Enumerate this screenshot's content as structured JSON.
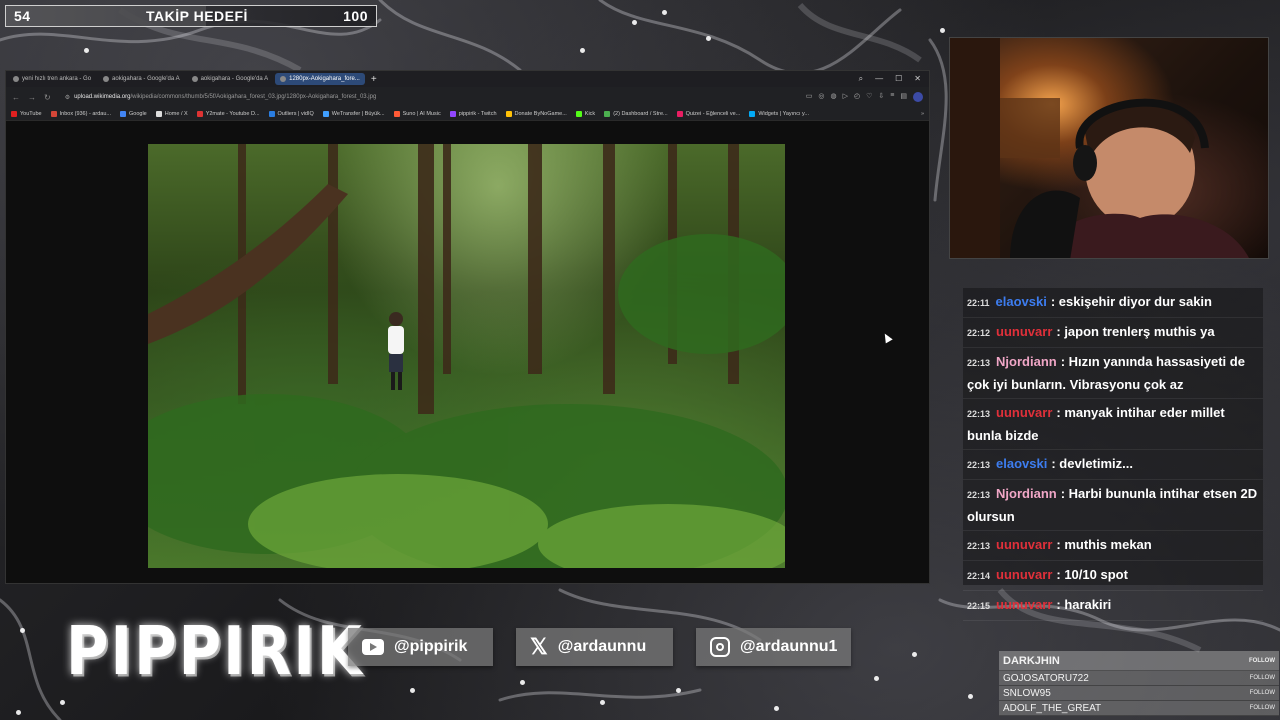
{
  "goal": {
    "current": "54",
    "title": "TAKİP HEDEFİ",
    "target": "100",
    "progress_fraction": 0.54
  },
  "browser": {
    "tabs": [
      {
        "label": "yeni hızlı tren ankara - Go",
        "active": false
      },
      {
        "label": "aokigahara - Google'da A",
        "active": false
      },
      {
        "label": "aokigahara - Google'da A",
        "active": false
      },
      {
        "label": "1280px-Aokigahara_fore...",
        "active": true
      }
    ],
    "url_host": "upload.wikimedia.org",
    "url_path": "/wikipedia/commons/thumb/5/5f/Aokigahara_forest_03.jpg/1280px-Aokigahara_forest_03.jpg",
    "bookmarks": [
      {
        "label": "YouTube",
        "color": "#e02020"
      },
      {
        "label": "Inbox (936) - ardau...",
        "color": "#d44638"
      },
      {
        "label": "Google",
        "color": "#4285f4"
      },
      {
        "label": "Home / X",
        "color": "#dddddd"
      },
      {
        "label": "Y2mate - Youtube D...",
        "color": "#d33"
      },
      {
        "label": "Outliers | vidIQ",
        "color": "#2a7de1"
      },
      {
        "label": "WeTransfer | Büyük...",
        "color": "#409fff"
      },
      {
        "label": "Suno | AI Music",
        "color": "#ff5a36"
      },
      {
        "label": "pippirik - Twitch",
        "color": "#9146ff"
      },
      {
        "label": "Donate ByNoGame...",
        "color": "#ffc107"
      },
      {
        "label": "Kick",
        "color": "#53fc18"
      },
      {
        "label": "(2) Dashboard / Stre...",
        "color": "#4caf50"
      },
      {
        "label": "Quizei - Eğlenceli ve...",
        "color": "#e91e63"
      },
      {
        "label": "Widgets | Yayıncı y...",
        "color": "#03a9f4"
      }
    ]
  },
  "chat": {
    "messages": [
      {
        "time": "22:11",
        "user": "elaovski",
        "color": "#3d7df0",
        "text": ": eskişehir diyor dur sakin"
      },
      {
        "time": "22:12",
        "user": "uunuvarr",
        "color": "#e0303a",
        "text": ": japon trenlerş muthis ya"
      },
      {
        "time": "22:13",
        "user": "Njordiann",
        "color": "#f0a6c6",
        "text": ": Hızın yanında hassasiyeti de çok iyi bunların. Vibrasyonu çok az"
      },
      {
        "time": "22:13",
        "user": "uunuvarr",
        "color": "#e0303a",
        "text": ": manyak intihar eder millet bunla bizde"
      },
      {
        "time": "22:13",
        "user": "elaovski",
        "color": "#3d7df0",
        "text": ": devletimiz..."
      },
      {
        "time": "22:13",
        "user": "Njordiann",
        "color": "#f0a6c6",
        "text": ": Harbi bununla intihar etsen 2D olursun"
      },
      {
        "time": "22:13",
        "user": "uunuvarr",
        "color": "#e0303a",
        "text": ": muthis mekan"
      },
      {
        "time": "22:14",
        "user": "uunuvarr",
        "color": "#e0303a",
        "text": ": 10/10 spot"
      },
      {
        "time": "22:15",
        "user": "uunuvarr",
        "color": "#e0303a",
        "text": ": harakiri"
      }
    ]
  },
  "logo": "PIPPIRIK",
  "socials": {
    "youtube": "@pippirik",
    "x": "@ardaunnu",
    "instagram": "@ardaunnu1"
  },
  "followers": {
    "tag": "FOLLOW",
    "names": [
      "DARKJHIN",
      "GOJOSATORU722",
      "SNLOW95",
      "ADOLF_THE_GREAT"
    ]
  }
}
